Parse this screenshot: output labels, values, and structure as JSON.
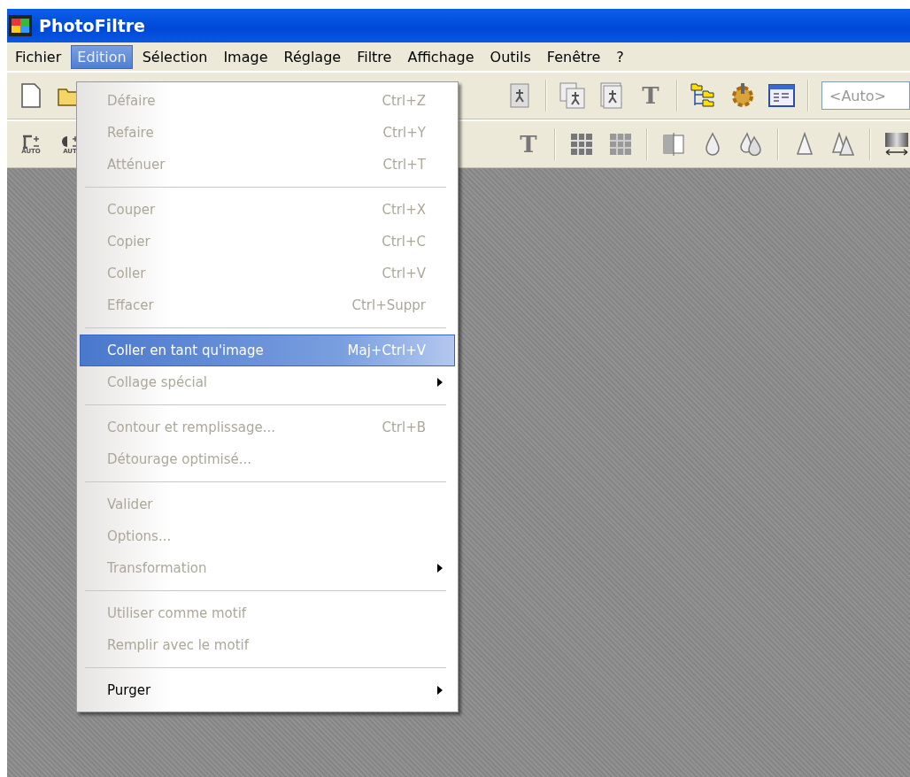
{
  "window": {
    "title": "PhotoFiltre"
  },
  "menubar": [
    {
      "label": "Fichier",
      "selected": false
    },
    {
      "label": "Edition",
      "selected": true
    },
    {
      "label": "Sélection",
      "selected": false
    },
    {
      "label": "Image",
      "selected": false
    },
    {
      "label": "Réglage",
      "selected": false
    },
    {
      "label": "Filtre",
      "selected": false
    },
    {
      "label": "Affichage",
      "selected": false
    },
    {
      "label": "Outils",
      "selected": false
    },
    {
      "label": "Fenêtre",
      "selected": false
    },
    {
      "label": "?",
      "selected": false
    }
  ],
  "toolbars": [
    {
      "left": [
        {
          "kind": "new"
        },
        {
          "kind": "folder"
        }
      ],
      "right": [
        {
          "kind": "walker"
        },
        {
          "kind": "sep"
        },
        {
          "kind": "walker-pages"
        },
        {
          "kind": "walker-page"
        },
        {
          "kind": "glyph",
          "text": "T"
        },
        {
          "kind": "sep"
        },
        {
          "kind": "tree"
        },
        {
          "kind": "gear"
        },
        {
          "kind": "window"
        },
        {
          "kind": "sep"
        },
        {
          "kind": "field",
          "placeholder": "<Auto>"
        }
      ]
    },
    {
      "left": [
        {
          "kind": "gamma",
          "text": "AUTO"
        },
        {
          "kind": "contrast",
          "text": "AUT"
        }
      ],
      "right": [
        {
          "kind": "glyph-plus",
          "text": "T"
        },
        {
          "kind": "sep"
        },
        {
          "kind": "grid"
        },
        {
          "kind": "grid-light"
        },
        {
          "kind": "sep"
        },
        {
          "kind": "half"
        },
        {
          "kind": "drop"
        },
        {
          "kind": "drops"
        },
        {
          "kind": "sep"
        },
        {
          "kind": "cone"
        },
        {
          "kind": "cones"
        },
        {
          "kind": "sep"
        },
        {
          "kind": "gradient"
        }
      ]
    }
  ],
  "menu": [
    {
      "kind": "item",
      "label": "Défaire",
      "shortcut": "Ctrl+Z",
      "disabled": true,
      "selected": false,
      "submenu": false
    },
    {
      "kind": "item",
      "label": "Refaire",
      "shortcut": "Ctrl+Y",
      "disabled": true,
      "selected": false,
      "submenu": false
    },
    {
      "kind": "item",
      "label": "Atténuer",
      "shortcut": "Ctrl+T",
      "disabled": true,
      "selected": false,
      "submenu": false
    },
    {
      "kind": "separator"
    },
    {
      "kind": "item",
      "label": "Couper",
      "shortcut": "Ctrl+X",
      "disabled": true,
      "selected": false,
      "submenu": false
    },
    {
      "kind": "item",
      "label": "Copier",
      "shortcut": "Ctrl+C",
      "disabled": true,
      "selected": false,
      "submenu": false
    },
    {
      "kind": "item",
      "label": "Coller",
      "shortcut": "Ctrl+V",
      "disabled": true,
      "selected": false,
      "submenu": false
    },
    {
      "kind": "item",
      "label": "Effacer",
      "shortcut": "Ctrl+Suppr",
      "disabled": true,
      "selected": false,
      "submenu": false
    },
    {
      "kind": "separator"
    },
    {
      "kind": "item",
      "label": "Coller en tant qu'image",
      "shortcut": "Maj+Ctrl+V",
      "disabled": false,
      "selected": true,
      "submenu": false
    },
    {
      "kind": "item",
      "label": "Collage spécial",
      "disabled": true,
      "selected": false,
      "submenu": true
    },
    {
      "kind": "separator"
    },
    {
      "kind": "item",
      "label": "Contour et remplissage...",
      "shortcut": "Ctrl+B",
      "disabled": true,
      "selected": false,
      "submenu": false
    },
    {
      "kind": "item",
      "label": "Détourage optimisé...",
      "disabled": true,
      "selected": false,
      "submenu": false
    },
    {
      "kind": "separator"
    },
    {
      "kind": "item",
      "label": "Valider",
      "disabled": true,
      "selected": false,
      "submenu": false
    },
    {
      "kind": "item",
      "label": "Options...",
      "disabled": true,
      "selected": false,
      "submenu": false
    },
    {
      "kind": "item",
      "label": "Transformation",
      "disabled": true,
      "selected": false,
      "submenu": true
    },
    {
      "kind": "separator"
    },
    {
      "kind": "item",
      "label": "Utiliser comme motif",
      "disabled": true,
      "selected": false,
      "submenu": false
    },
    {
      "kind": "item",
      "label": "Remplir avec le motif",
      "disabled": true,
      "selected": false,
      "submenu": false
    },
    {
      "kind": "separator"
    },
    {
      "kind": "item",
      "label": "Purger",
      "disabled": false,
      "selected": false,
      "submenu": true
    }
  ]
}
